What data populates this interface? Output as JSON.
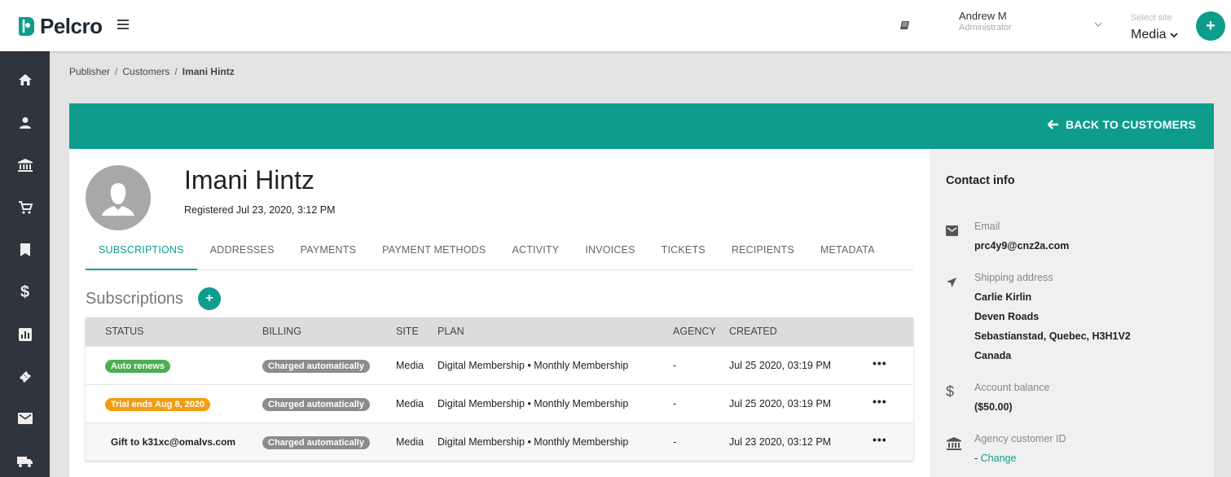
{
  "brand": {
    "name": "Pelcro",
    "accent": "#0e9d8c"
  },
  "topbar": {
    "user_name": "Andrew M",
    "user_role": "Administrator",
    "site_label": "Select site",
    "site_value": "Media"
  },
  "sidebar": {
    "items": [
      "home-icon",
      "person-icon",
      "bank-icon",
      "cart-icon",
      "bookmark-icon",
      "dollar-icon",
      "chart-icon",
      "ticket-icon",
      "mail-icon",
      "truck-icon"
    ]
  },
  "breadcrumb": {
    "items": [
      "Publisher",
      "Customers",
      "Imani Hintz"
    ],
    "sep": "/"
  },
  "header": {
    "back_label": "BACK TO CUSTOMERS"
  },
  "customer": {
    "name": "Imani Hintz",
    "registered": "Registered Jul 23, 2020, 3:12 PM"
  },
  "tabs": [
    "SUBSCRIPTIONS",
    "ADDRESSES",
    "PAYMENTS",
    "PAYMENT METHODS",
    "ACTIVITY",
    "INVOICES",
    "TICKETS",
    "RECIPIENTS",
    "METADATA"
  ],
  "subscriptions": {
    "title": "Subscriptions",
    "add_label": "+",
    "columns": [
      "STATUS",
      "BILLING",
      "SITE",
      "PLAN",
      "AGENCY",
      "CREATED"
    ],
    "rows": [
      {
        "status": "Auto renews",
        "billing": "Charged automatically",
        "site": "Media",
        "plan": "Digital Membership • Monthly Membership",
        "agency": "-",
        "created": "Jul 25 2020, 03:19 PM",
        "actions": "•••"
      },
      {
        "status": "Trial ends Aug 8, 2020",
        "billing": "Charged automatically",
        "site": "Media",
        "plan": "Digital Membership • Monthly Membership",
        "agency": "-",
        "created": "Jul 25 2020, 03:19 PM",
        "actions": "•••"
      },
      {
        "status": "Gift to k31xc@omalvs.com",
        "billing": "Charged automatically",
        "site": "Media",
        "plan": "Digital Membership • Monthly Membership",
        "agency": "-",
        "created": "Jul 23 2020, 03:12 PM",
        "actions": "•••"
      }
    ]
  },
  "contact": {
    "title": "Contact info",
    "email_label": "Email",
    "email": "prc4y9@cnz2a.com",
    "shipping_label": "Shipping address",
    "shipping_lines": [
      "Carlie Kirlin",
      "Deven Roads",
      "Sebastianstad, Quebec, H3H1V2",
      "Canada"
    ],
    "balance_label": "Account balance",
    "balance": "($50.00)",
    "agency_label": "Agency customer ID",
    "agency_value": "-",
    "agency_change": "Change"
  }
}
